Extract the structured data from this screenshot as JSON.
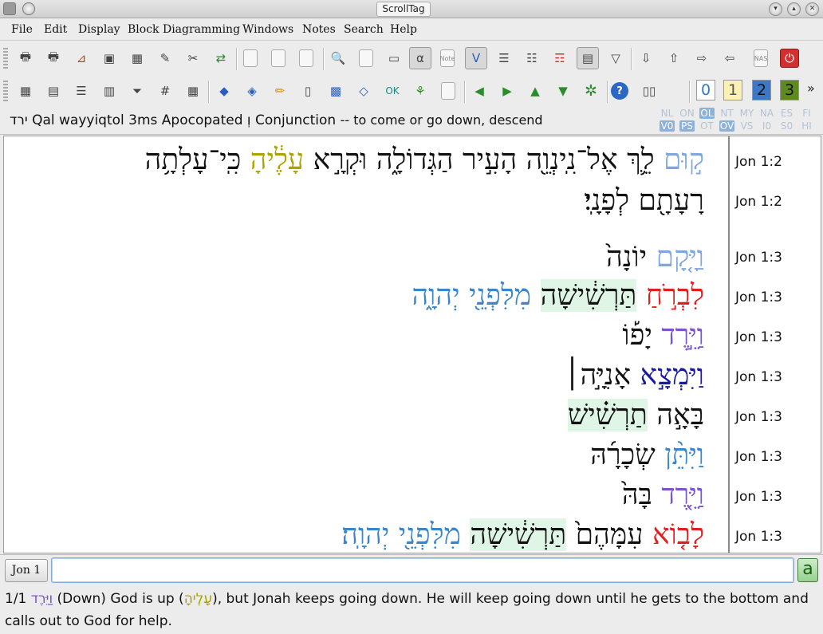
{
  "window": {
    "title": "ScrollTag"
  },
  "menu": [
    "File",
    "Edit",
    "Display",
    "Block Diagramming",
    "Windows",
    "Notes",
    "Search",
    "Help"
  ],
  "toolbar1": {
    "icons": [
      "print-icon",
      "print-preview-icon",
      "pdf-icon",
      "save-icon",
      "table-icon",
      "edit-icon",
      "tools-icon",
      "refresh-icon",
      "copy-icon",
      "copy2-icon",
      "copy3-icon",
      "zoom-icon",
      "page-icon",
      "line-icon",
      "alpha-icon",
      "note-icon",
      "v-icon",
      "numbered-list-icon",
      "ab-icon",
      "hierarchy-icon",
      "document-icon",
      "filter-icon",
      "move-down-icon",
      "move-up-icon",
      "move-right-icon",
      "move-left-icon",
      "nas-icon",
      "power-icon"
    ],
    "note_label": "Note",
    "nas_label": "NAS"
  },
  "toolbar2": {
    "icons": [
      "grid-icon",
      "layout-icon",
      "list-icon",
      "columns-icon",
      "funnel-icon",
      "hash-icon",
      "table2-icon",
      "tag-icon",
      "tag2-icon",
      "pencil-icon",
      "eraser-icon",
      "grid-tag-icon",
      "tag-edit-icon",
      "hebrew-og-icon",
      "tree-icon",
      "lines-icon",
      "prev-icon",
      "next-icon",
      "up-icon",
      "down-icon",
      "star-icon",
      "help-icon",
      "book-icon"
    ],
    "levels": [
      "0",
      "1",
      "2",
      "3"
    ],
    "more": "»"
  },
  "info": {
    "lemma": "ירד",
    "parse": "Qal wayyiqtol 3ms Apocopated",
    "prefix": "וְ",
    "conj": "Conjunction",
    "gloss": "-- to come or go down, descend",
    "flags_row1": [
      "NL",
      "ON",
      "OL",
      "NT",
      "MY",
      "NA",
      "ES",
      "FI"
    ],
    "flags_row2": [
      "V0",
      "PS",
      "OT",
      "OV",
      "VS",
      "I0",
      "S0",
      "HI"
    ]
  },
  "lines": [
    {
      "ref": "Jon 1:2",
      "words": [
        {
          "t": "ק֣וּם",
          "c": "LightBlue"
        },
        {
          "t": "לֵ֛ךְ",
          "c": "Dark"
        },
        {
          "t": "אֶל־נִֽינְוֵ֖ה",
          "c": "Dark"
        },
        {
          "t": "הָעִ֣יר",
          "c": "Dark"
        },
        {
          "t": "הַגְּדוֹלָ֑ה",
          "c": "Dark"
        },
        {
          "t": "וּקְרָ֣א",
          "c": "Dark"
        },
        {
          "t": "עָלֶ֔יהָ",
          "c": "Olive"
        },
        {
          "t": "כִּֽי־עָלְתָ֥ה",
          "c": "Dark"
        }
      ]
    },
    {
      "ref": "Jon 1:2",
      "words": [
        {
          "t": "רָעָתָ֖ם",
          "c": "Dark"
        },
        {
          "t": "לְפָנָֽי׃",
          "c": "Dark"
        }
      ]
    },
    {
      "ref": "Jon 1:3",
      "words": [
        {
          "t": "וַיָּ֤קָם",
          "c": "LightBlue"
        },
        {
          "t": "יוֹנָה֙",
          "c": "Dark"
        }
      ]
    },
    {
      "ref": "Jon 1:3",
      "words": [
        {
          "t": "לִבְרֹ֣חַ",
          "c": "Red"
        },
        {
          "t": "תַּרְשִׁ֔ישָׁה",
          "c": "Dark",
          "hl": true
        },
        {
          "t": "מִלִּפְנֵ֖י יְהוָ֑ה",
          "c": "Blue"
        }
      ]
    },
    {
      "ref": "Jon 1:3",
      "words": [
        {
          "t": "וַיֵּ֣רֶד",
          "c": "Purple"
        },
        {
          "t": "יָפ֡וֹ",
          "c": "Dark"
        }
      ]
    },
    {
      "ref": "Jon 1:3",
      "words": [
        {
          "t": "וַיִּמְצָ֣א",
          "c": "Navy"
        },
        {
          "t": "אָנִיָּ֣ה׀",
          "c": "Dark"
        }
      ]
    },
    {
      "ref": "Jon 1:3",
      "words": [
        {
          "t": "בָּאָ֣ה",
          "c": "Dark"
        },
        {
          "t": "תַרְשִׁ֗ישׁ",
          "c": "Dark",
          "hl": true
        }
      ]
    },
    {
      "ref": "Jon 1:3",
      "words": [
        {
          "t": "וַיִּתֵּ֨ן",
          "c": "Blue"
        },
        {
          "t": "שְׂכָרָ֜הּ",
          "c": "Dark"
        }
      ]
    },
    {
      "ref": "Jon 1:3",
      "words": [
        {
          "t": "וַיֵּ֤רֶד",
          "c": "Purple"
        },
        {
          "t": "בָּהּ֙",
          "c": "Dark"
        }
      ]
    },
    {
      "ref": "Jon 1:3",
      "words": [
        {
          "t": "לָב֤וֹא",
          "c": "Red"
        },
        {
          "t": "עִמָּהֶם֙",
          "c": "Dark"
        },
        {
          "t": "תַּרְשִׁ֔ישָׁה",
          "c": "Dark",
          "hl": true
        },
        {
          "t": "מִלִּפְנֵ֖י יְהוָֽה׃",
          "c": "Blue"
        }
      ]
    }
  ],
  "bottom": {
    "ref_button": "Jon 1",
    "search_value": "",
    "a_button": "a"
  },
  "note": {
    "counter": "1/1",
    "word": "וַיֵּרֶד",
    "part1": "(Down) God is up (",
    "word2": "עָלֶיהָ",
    "part2": "), but Jonah keeps going down. He will keep going down until he gets to the bottom and calls out to God for help."
  },
  "colors": {
    "LightBlue": "#7ea6e0",
    "Blue": "#3a86c8",
    "Navy": "#1a1aa0",
    "Red": "#e01f1f",
    "Purple": "#7b55c9",
    "Olive": "#a8a500",
    "Dark": "#111111",
    "highlight": "#dff5e6"
  }
}
